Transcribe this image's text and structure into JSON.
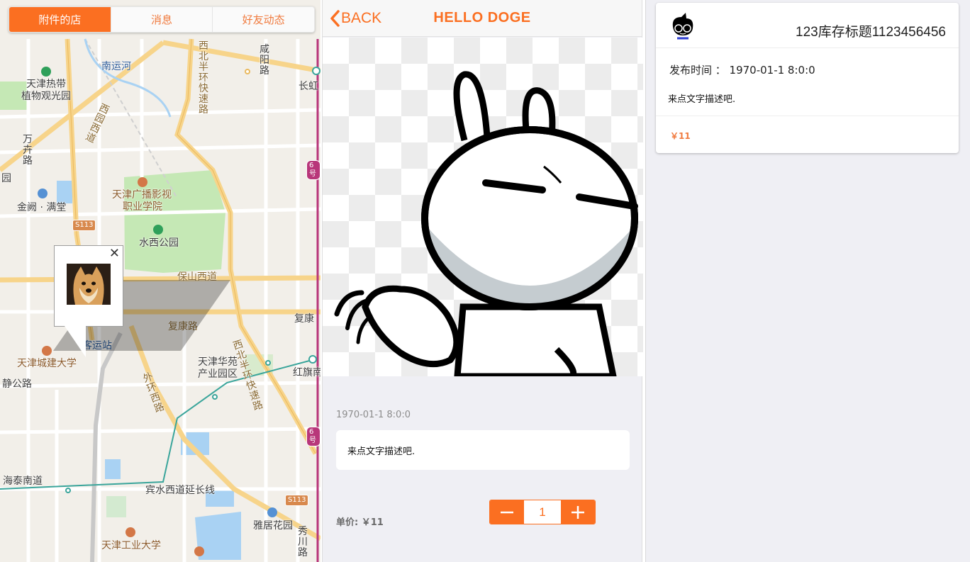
{
  "tabs": [
    {
      "label": "附件的店",
      "active": true
    },
    {
      "label": "消息",
      "active": false
    },
    {
      "label": "好友动态",
      "active": false
    }
  ],
  "map": {
    "labels": {
      "nanyunhe": "南运河",
      "redai1": "天津热带",
      "redai2": "植物观光园",
      "xibei_top": "西北半环快速路",
      "xianyang": "咸阳路",
      "changhong": "长虹",
      "xuanqi": "西园西道",
      "wanquan": "万卉路",
      "guang1": "天津广播影视",
      "guang2": "职业学院",
      "jinque": "金阙 · 满堂",
      "shuixi": "水西公园",
      "baoshan": "保山西道",
      "fukang": "复康路",
      "fukang_r": "复康",
      "keyunzhan": "客运站",
      "chengjian": "天津城建大学",
      "jinggong": "静公路",
      "huayuan1": "天津华苑",
      "huayuan2": "产业园区",
      "waihuan": "外环西路",
      "xibei_bottom": "西北半环快速路",
      "hongqi": "红旗南",
      "haitai": "海泰南道",
      "binshui": "宾水西道延长线",
      "yaju": "雅居花园",
      "xiuchuan": "秀川路",
      "gongye": "天津工业大学",
      "yuan": "园",
      "s113a": "S113",
      "s113b": "S113",
      "metro6a": "6号",
      "metro6b": "6号"
    }
  },
  "popup": {
    "close": "✕",
    "image": "doge-avatar"
  },
  "detail": {
    "back_label": "BACK",
    "title": "HELLO DOGE",
    "time": "1970-01-1 8:0:0",
    "description": "来点文字描述吧.",
    "price_label": "单价: ￥11",
    "quantity": "1"
  },
  "card": {
    "title": "123库存标题1123456456",
    "time_label": "发布时间 ：  1970-01-1 8:0:0",
    "description": "来点文字描述吧.",
    "price": "￥11",
    "avatar": "cartoon-avatar-with-sunglasses"
  },
  "colors": {
    "accent": "#fb6f21",
    "background": "#efeff4",
    "map_green": "#c5e8b5",
    "map_water": "#a9d2f3"
  }
}
